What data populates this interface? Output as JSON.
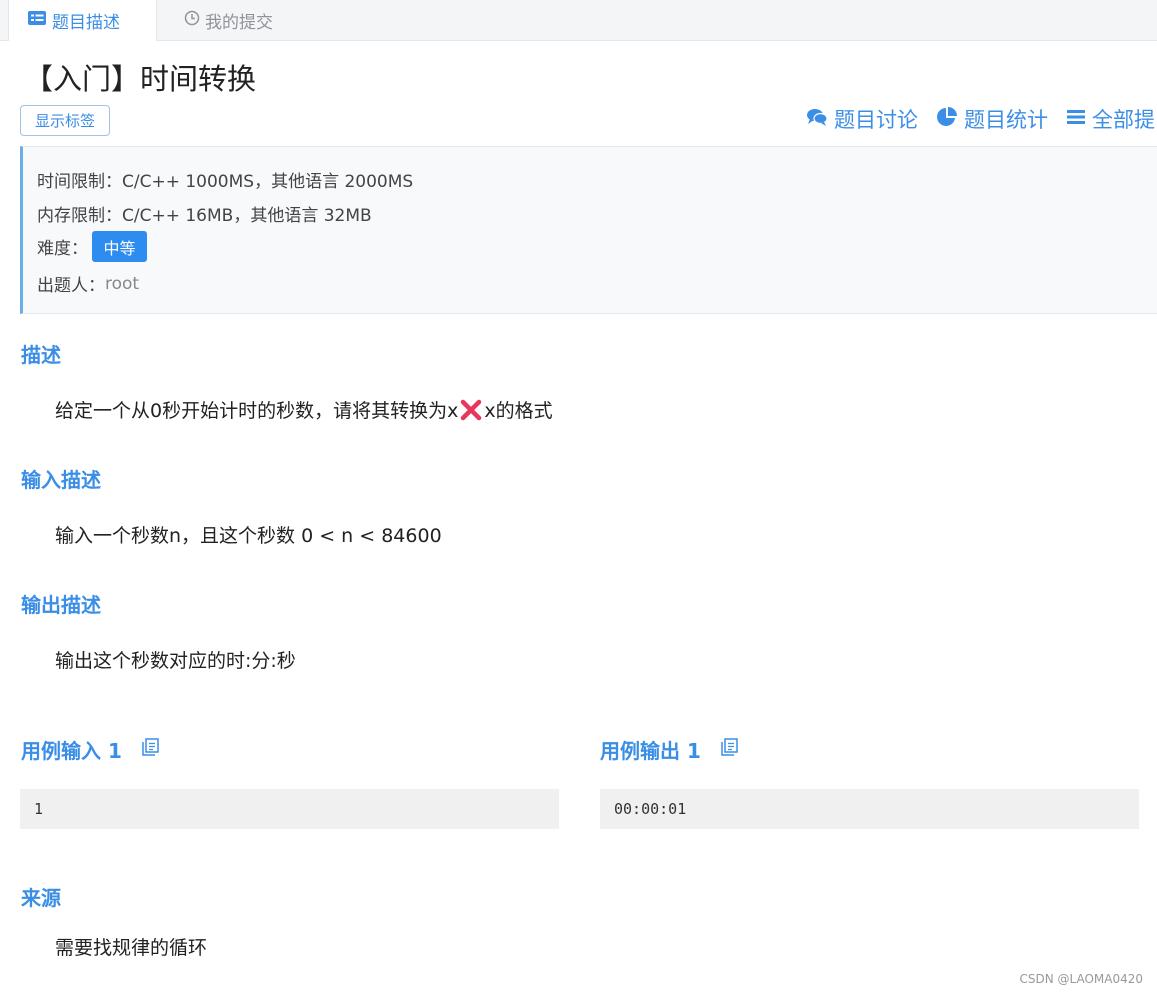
{
  "tabs": [
    {
      "label": "题目描述",
      "icon": "list-icon",
      "active": true
    },
    {
      "label": "我的提交",
      "icon": "clock-icon",
      "active": false
    }
  ],
  "problem": {
    "title": "【入门】时间转换",
    "show_tags_label": "显示标签"
  },
  "toolbar": {
    "discuss_label": "题目讨论",
    "stats_label": "题目统计",
    "all_label": "全部提"
  },
  "info": {
    "time_limit": "时间限制：C/C++ 1000MS，其他语言 2000MS",
    "memory_limit": "内存限制：C/C++ 16MB，其他语言 32MB",
    "difficulty_label": "难度：",
    "difficulty_value": "中等",
    "author_label": "出题人：",
    "author_value": "root"
  },
  "sections": {
    "description": {
      "heading": "描述",
      "text_before": "给定一个从0秒开始计时的秒数，请将其转换为x",
      "text_after": "x的格式"
    },
    "input": {
      "heading": "输入描述",
      "text": "输入一个秒数n，且这个秒数 0 < n < 84600"
    },
    "output": {
      "heading": "输出描述",
      "text": "输出这个秒数对应的时:分:秒"
    },
    "source": {
      "heading": "来源",
      "text": "需要找规律的循环"
    }
  },
  "samples": {
    "input_heading": "用例输入 1",
    "input_value": "1",
    "output_heading": "用例输出 1",
    "output_value": "00:00:01"
  },
  "watermark": "CSDN @LAOMA0420",
  "colors": {
    "accent": "#3a8ee6",
    "badge": "#2d8cf0",
    "cross": "#e8365d"
  }
}
